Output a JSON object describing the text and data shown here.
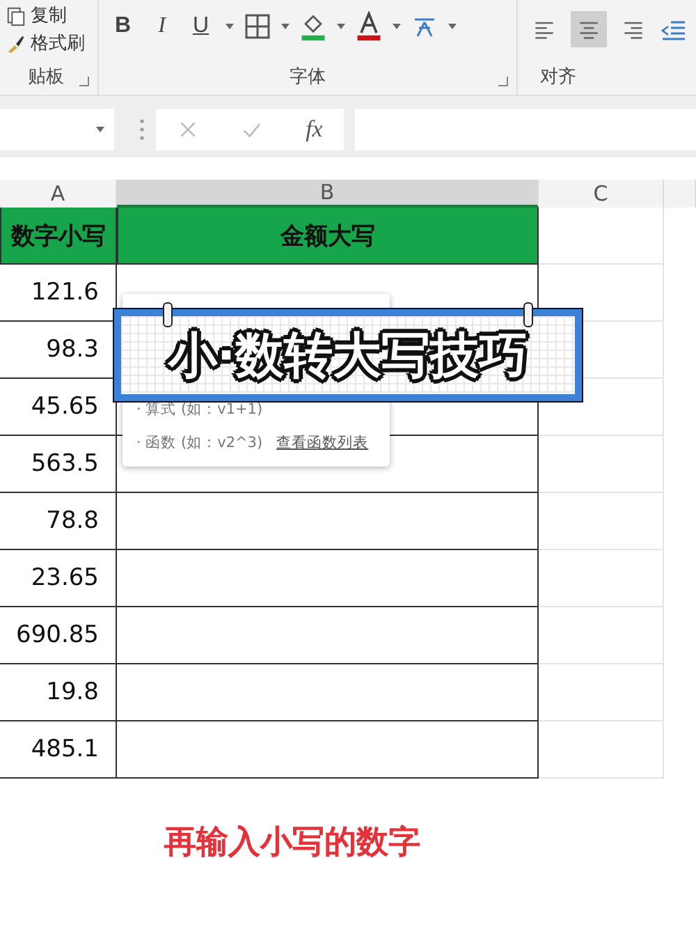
{
  "ribbon": {
    "clipboard": {
      "label": "贴板",
      "buttons": [
        "复制",
        "格式刷"
      ]
    },
    "font": {
      "label": "字体",
      "style_buttons": [
        {
          "kind": "bold",
          "text": "B"
        },
        {
          "kind": "italic",
          "text": "I"
        },
        {
          "kind": "underline",
          "text": "U"
        }
      ]
    },
    "alignment": {
      "label": "对齐",
      "buttons": [
        {
          "kind": "left",
          "selected": false
        },
        {
          "kind": "center",
          "selected": true
        },
        {
          "kind": "right",
          "selected": false
        }
      ]
    }
  },
  "formula_bar": {
    "function_label": "fx"
  },
  "sheet": {
    "columns": [
      {
        "label": "A",
        "selected": false
      },
      {
        "label": "B",
        "selected": true
      },
      {
        "label": "C",
        "selected": false
      }
    ],
    "header_row": [
      "数字小写",
      "金额大写"
    ],
    "rows": [
      "121.6",
      "98.3",
      "45.65",
      "563.5",
      "78.8",
      "23.65",
      "690.85",
      "19.8",
      "485.1"
    ]
  },
  "tooltip": {
    "lines": [
      "· 算式 (如：v1+1)",
      "· 函数 (如：v2^3)"
    ],
    "link": "查看函数列表"
  },
  "banner": {
    "title": "小·数转大写技巧"
  },
  "caption": "再输入小写的数字"
}
